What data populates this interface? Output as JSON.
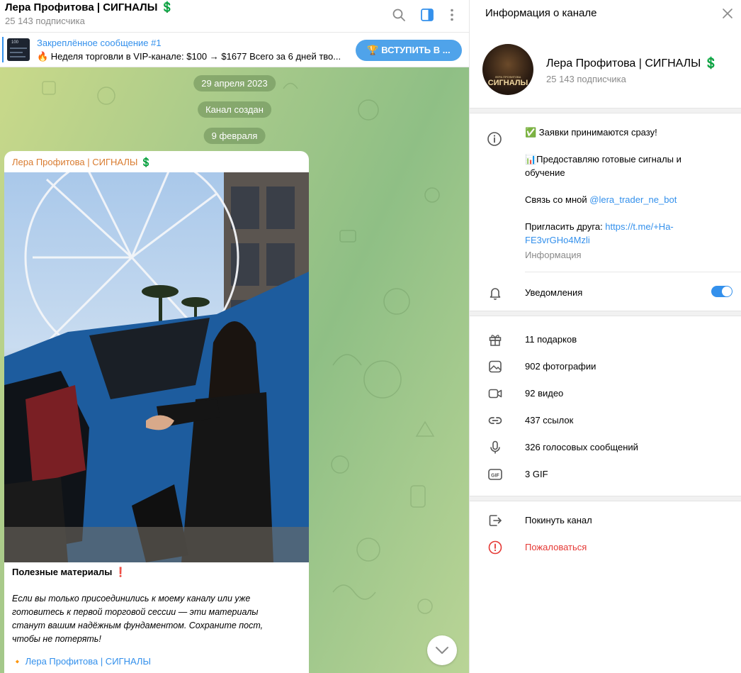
{
  "header": {
    "title": "Лера Профитова | СИГНАЛЫ 💲",
    "subscribers": "25 143 подписчика"
  },
  "pinned": {
    "title": "Закреплённое сообщение #1",
    "text": "🔥 Неделя торговли в VIP-канале: $100 → $1677  Всего за 6 дней тво...",
    "join_label": "🏆 ВСТУПИТЬ В ...",
    "thumb_text": "100"
  },
  "chat": {
    "date1": "29 апреля 2023",
    "created": "Канал создан",
    "date2": "9 февраля",
    "message": {
      "author": "Лера Профитова | СИГНАЛЫ 💲",
      "heading": "Полезные материалы ❗",
      "body": "Если вы только присоединились к моему каналу или уже готовитесь к первой торговой сессии — эти материалы станут вашим надёжным фундаментом. Сохраните пост, чтобы не потерять!",
      "signature_prefix": "🔸",
      "signature": "Лера Профитова | СИГНАЛЫ"
    }
  },
  "panel": {
    "title": "Информация о канале",
    "channel_name": "Лера Профитова | СИГНАЛЫ 💲",
    "subscribers": "25 143 подписчика",
    "avatar_caption_top": "ЛЕРА ПРОФИТОВА",
    "avatar_caption": "СИГНАЛЫ",
    "description": {
      "line1": "✅ Заявки принимаются сразу!",
      "line2": "📊Предоставляю готовые сигналы и обучение",
      "contact_prefix": "Связь со мной ",
      "contact_link": "@lera_trader_ne_bot",
      "invite_prefix": "Пригласить друга: ",
      "invite_link": "https://t.me/+Ha-FE3vrGHo4Mzli",
      "info_label": "Информация"
    },
    "notifications_label": "Уведомления",
    "notifications_on": true,
    "media": {
      "gifts": "11 подарков",
      "photos": "902 фотографии",
      "videos": "92 видео",
      "links": "437 ссылок",
      "voice": "326 голосовых сообщений",
      "gif": "3 GIF"
    },
    "actions": {
      "leave": "Покинуть канал",
      "report": "Пожаловаться"
    }
  },
  "colors": {
    "accent": "#3390ec",
    "author": "#d97b2f",
    "danger": "#e53935"
  }
}
